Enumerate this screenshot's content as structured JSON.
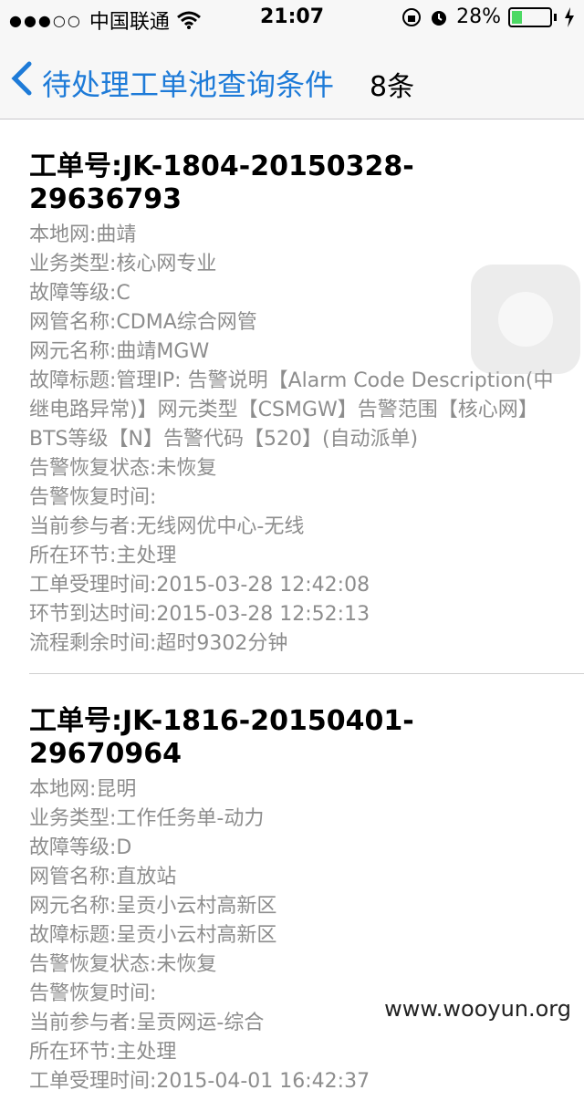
{
  "status": {
    "signal_dots": "●●●○○",
    "carrier": "中国联通",
    "time": "21:07",
    "battery": "28%",
    "battery_fraction": 0.28
  },
  "nav": {
    "title": "待处理工单池查询条件",
    "count": "8条"
  },
  "orders": [
    {
      "id": "工单号:JK-1804-20150328-29636793",
      "lines": [
        "本地网:曲靖",
        "业务类型:核心网专业",
        "故障等级:C",
        "网管名称:CDMA综合网管",
        "网元名称:曲靖MGW",
        "故障标题:管理IP: 告警说明【Alarm Code Description(中继电路异常)】网元类型【CSMGW】告警范围【核心网】BTS等级【N】告警代码【520】(自动派单)",
        "告警恢复状态:未恢复",
        "告警恢复时间:",
        "当前参与者:无线网优中心-无线",
        "所在环节:主处理",
        "工单受理时间:2015-03-28 12:42:08",
        "环节到达时间:2015-03-28 12:52:13",
        "流程剩余时间:超时9302分钟"
      ]
    },
    {
      "id": "工单号:JK-1816-20150401-29670964",
      "lines": [
        "本地网:昆明",
        "业务类型:工作任务单-动力",
        "故障等级:D",
        "网管名称:直放站",
        "网元名称:呈贡小云村高新区",
        "故障标题:呈贡小云村高新区",
        "告警恢复状态:未恢复",
        "告警恢复时间:",
        "当前参与者:呈贡网运-综合",
        "所在环节:主处理",
        "工单受理时间:2015-04-01 16:42:37"
      ]
    }
  ],
  "watermark": "www.wooyun.org",
  "colors": {
    "accent": "#1e7bd8",
    "label_gray": "#8d8d8d",
    "battery_green": "#4cd964"
  }
}
